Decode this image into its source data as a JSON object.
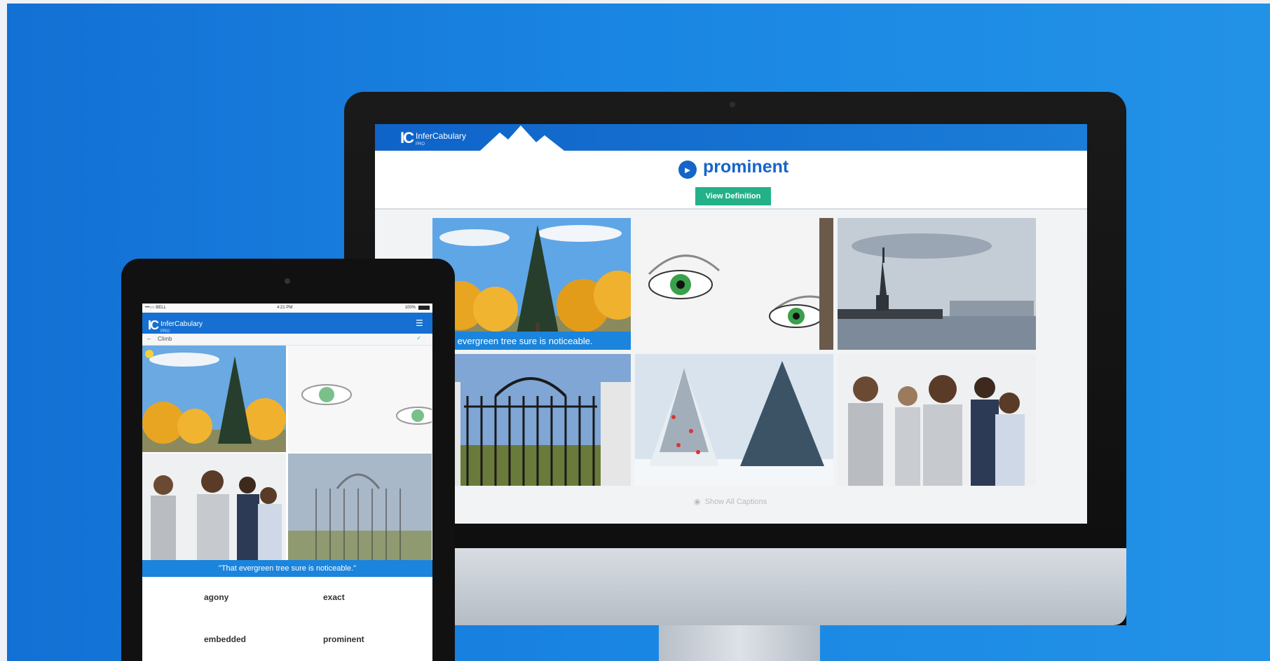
{
  "desktop": {
    "app_name": "InferCabulary",
    "app_badge": "PRO",
    "logo_mark": "IC",
    "word": "prominent",
    "speaker_icon": "speaker-icon",
    "view_definition_label": "View Definition",
    "tiles": [
      {
        "scene": "evergreen tree among autumn trees",
        "caption": "That evergreen tree sure is noticeable."
      },
      {
        "scene": "green eyes close-up",
        "caption": ""
      },
      {
        "scene": "statue of liberty",
        "caption": ""
      },
      {
        "scene": "iron gate",
        "caption": ""
      },
      {
        "scene": "snowy christmas tree",
        "caption": ""
      },
      {
        "scene": "business people group",
        "caption": ""
      }
    ],
    "show_captions_label": "Show All Captions"
  },
  "tablet": {
    "status": {
      "carrier": "•••○○ BELL",
      "time": "4:21 PM",
      "battery": "100%"
    },
    "app_name": "InferCabulary",
    "app_badge": "PRO",
    "logo_mark": "IC",
    "sub_label": "Climb",
    "caption": "\"That evergreen tree sure is noticeable.\"",
    "choices": [
      "agony",
      "exact",
      "embedded",
      "prominent"
    ]
  }
}
